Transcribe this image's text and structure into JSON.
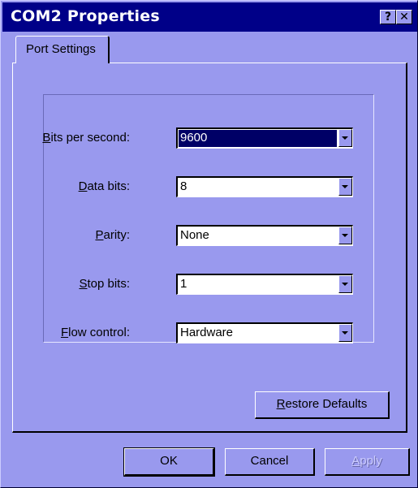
{
  "window": {
    "title": "COM2 Properties",
    "help_glyph": "?",
    "close_glyph": "✕"
  },
  "tabs": [
    {
      "label": "Port Settings",
      "active": true
    }
  ],
  "fields": [
    {
      "mnemonic": "B",
      "label_rest": "its per second:",
      "value": "9600",
      "focused": true
    },
    {
      "mnemonic": "D",
      "label_rest": "ata bits:",
      "value": "8"
    },
    {
      "mnemonic": "P",
      "label_rest": "arity:",
      "value": "None"
    },
    {
      "mnemonic": "S",
      "label_rest": "top bits:",
      "value": "1"
    },
    {
      "mnemonic": "F",
      "label_rest": "low control:",
      "value": "Hardware"
    }
  ],
  "buttons": {
    "restore_mnemonic": "R",
    "restore_rest": "estore Defaults",
    "ok": "OK",
    "cancel": "Cancel",
    "apply_mnemonic": "A",
    "apply_rest": "pply"
  },
  "colors": {
    "face": "#9999ee",
    "titlebar": "#000088",
    "selection": "#000066"
  }
}
